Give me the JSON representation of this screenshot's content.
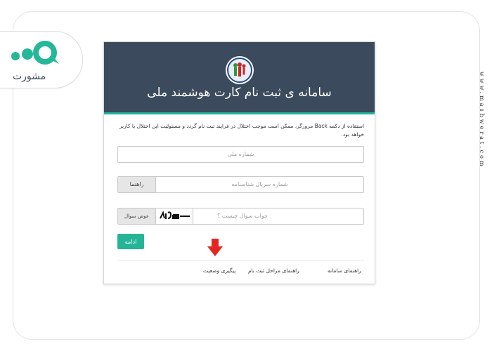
{
  "watermark": {
    "brand": "مشورت",
    "site": "www.mashwerat.com"
  },
  "card": {
    "title": "سامانه ی ثبت نام کارت هوشمند ملی",
    "notice": "استفاده از دکمه Back مرورگر، ممکن است موجب اختلال در فرایند ثبت نام گردد و مسئولیت این اختلال با کاربر خواهد بود.",
    "national_id": {
      "placeholder": "شماره ملی"
    },
    "serial": {
      "placeholder": "شماره سریال شناسنامه",
      "help_label": "راهنما"
    },
    "captcha": {
      "placeholder": "جواب سوال چیست ؟",
      "change_label": "عوض سوال"
    },
    "continue_label": "ادامه",
    "links": {
      "system_guide": "راهنمای سامانه",
      "steps_guide": "راهنمای مراحل ثبت نام",
      "status_tracking": "پیگیری وضعیت"
    }
  },
  "colors": {
    "header": "#3b4a5c",
    "accent": "#25b596",
    "arrow": "#e52620"
  }
}
